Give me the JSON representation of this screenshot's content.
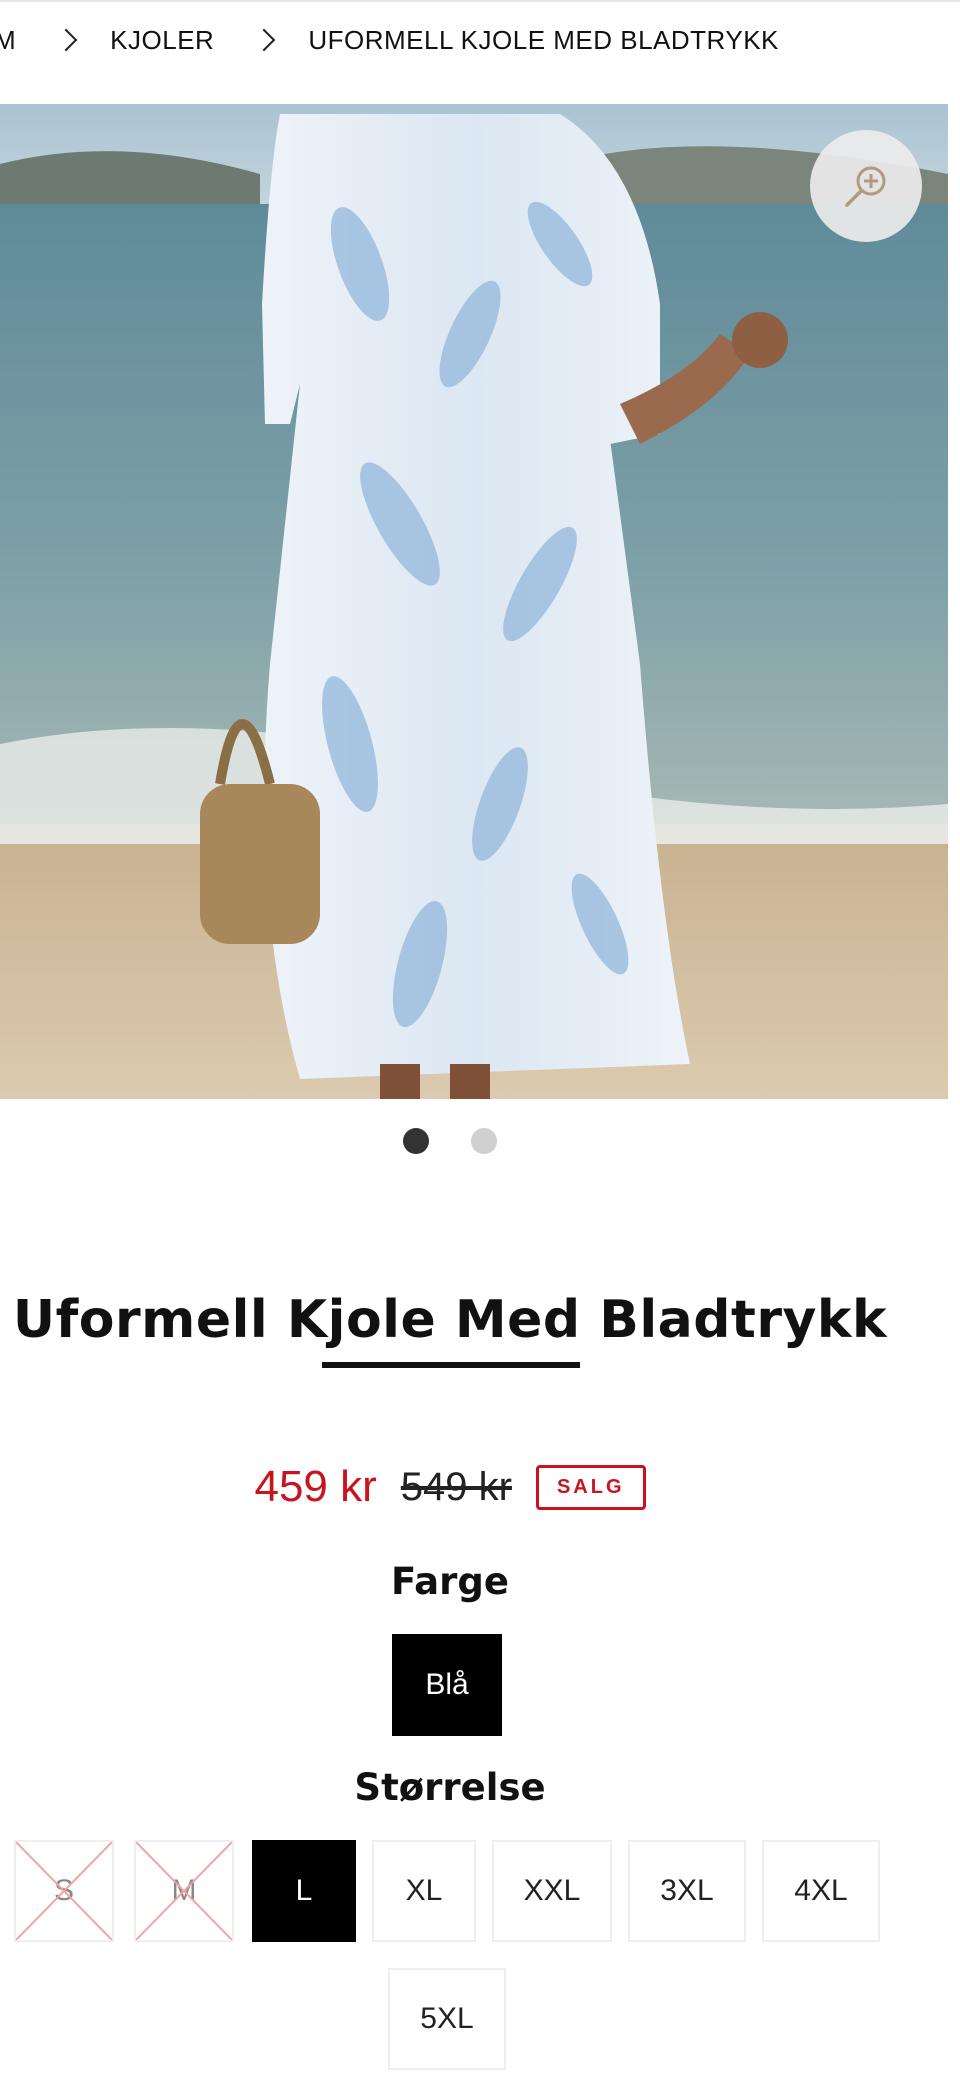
{
  "breadcrumb": {
    "items": [
      "M",
      "KJOLER",
      "UFORMELL KJOLE MED BLADTRYKK"
    ]
  },
  "gallery": {
    "image_description_icon": "product-photo",
    "dots": [
      true,
      false
    ]
  },
  "product": {
    "title": "Uformell Kjole Med Bladtrykk",
    "sale_price": "459 kr",
    "original_price": "549 kr",
    "badge": "SALG"
  },
  "color": {
    "label": "Farge",
    "selected": "Blå"
  },
  "size": {
    "label": "Størrelse",
    "options": [
      {
        "label": "S",
        "state": "disabled"
      },
      {
        "label": "M",
        "state": "disabled"
      },
      {
        "label": "L",
        "state": "selected"
      },
      {
        "label": "XL",
        "state": "available"
      },
      {
        "label": "XXL",
        "state": "available"
      },
      {
        "label": "3XL",
        "state": "available"
      },
      {
        "label": "4XL",
        "state": "available"
      },
      {
        "label": "5XL",
        "state": "available"
      }
    ]
  },
  "colors": {
    "sale_red": "#c8141e",
    "selected_bg": "#000000"
  }
}
